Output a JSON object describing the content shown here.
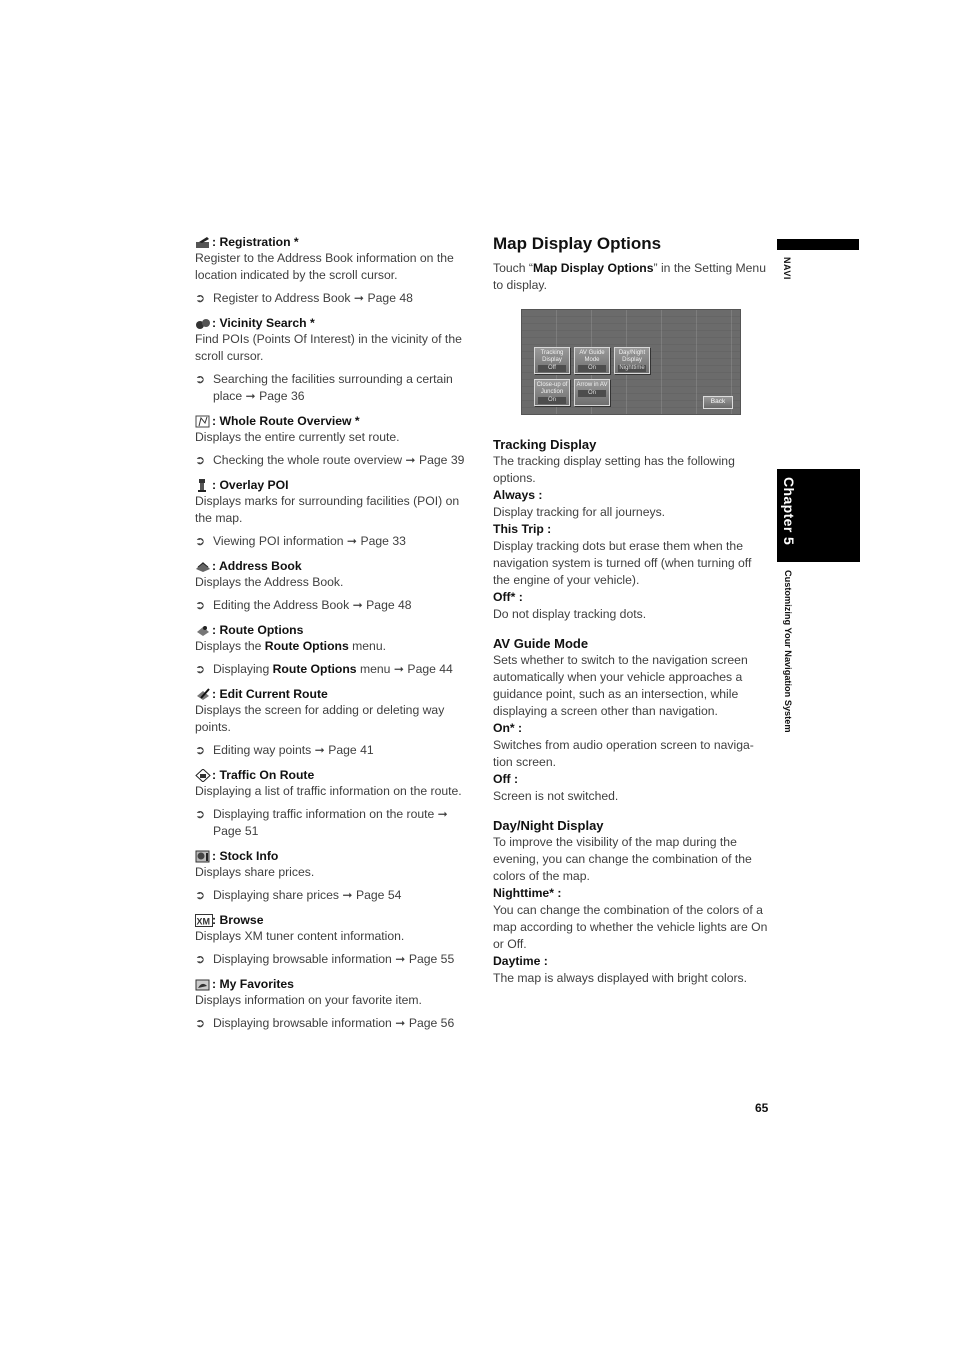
{
  "left_column": {
    "entries": [
      {
        "icon": "registration-icon",
        "title": ": Registration *",
        "desc": "Register to the Address Book information on the location indicated by the scroll cursor.",
        "ref": "Register to Address Book ➞ Page 48"
      },
      {
        "icon": "vicinity-search-icon",
        "title": ": Vicinity Search *",
        "desc": "Find POIs (Points Of Interest) in the vicinity of the scroll cursor.",
        "ref": "Searching the facilities surrounding a certain place ➞ Page 36"
      },
      {
        "icon": "whole-route-overview-icon",
        "title": ": Whole Route Overview *",
        "desc": "Displays the entire currently set route.",
        "ref": "Checking the whole route overview ➞ Page 39"
      },
      {
        "icon": "overlay-poi-icon",
        "title": " : Overlay POI",
        "desc": "Displays marks for surrounding facilities (POI) on the map.",
        "ref": "Viewing POI information ➞ Page 33"
      },
      {
        "icon": "address-book-icon",
        "title": ": Address Book",
        "desc": "Displays the Address Book.",
        "ref": "Editing the Address Book ➞ Page 48"
      },
      {
        "icon": "route-options-icon",
        "title": ": Route Options",
        "desc_pre": "Displays the ",
        "desc_bold": "Route Options",
        "desc_post": " menu.",
        "ref_pre": "Displaying ",
        "ref_bold": "Route Options",
        "ref_post": " menu ➞ Page 44"
      },
      {
        "icon": "edit-current-route-icon",
        "title": ": Edit Current Route",
        "desc": "Displays the screen for adding or deleting way points.",
        "ref": "Editing way points ➞ Page 41"
      },
      {
        "icon": "traffic-on-route-icon",
        "title": ": Traffic On Route",
        "desc": "Displaying a list of traffic information on the route.",
        "ref": "Displaying traffic information on the route ➞ Page 51"
      },
      {
        "icon": "stock-info-icon",
        "title": ": Stock Info",
        "desc": "Displays share prices.",
        "ref": "Displaying share prices ➞ Page 54"
      },
      {
        "icon": "xm-browse-icon",
        "title": " : Browse",
        "desc": "Displays XM tuner content information.",
        "ref": "Displaying browsable information ➞ Page 55"
      },
      {
        "icon": "my-favorites-icon",
        "title": ": My Favorites",
        "desc": "Displays information on your favorite item.",
        "ref": "Displaying browsable information ➞ Page 56"
      }
    ],
    "bullet": "➲"
  },
  "right_column": {
    "title": "Map Display Options",
    "intro_pre": "Touch “",
    "intro_bold": "Map Display Options",
    "intro_post": "” in the Setting Menu to display.",
    "screen": {
      "buttons": [
        {
          "label": "Tracking Display",
          "value": "Off"
        },
        {
          "label": "AV Guide Mode",
          "value": "On"
        },
        {
          "label": "Day/Night Display",
          "value": "Nighttime"
        },
        {
          "label": "Close-up of Junction",
          "value": "On"
        },
        {
          "label": "Arrow in AV",
          "value": "On"
        }
      ],
      "back": "Back"
    },
    "sections": [
      {
        "heading": "Tracking Display",
        "intro": "The tracking display setting has the following options.",
        "options": [
          {
            "label": "Always :",
            "text": "Display tracking for all journeys."
          },
          {
            "label": "This Trip :",
            "text": "Display tracking dots but erase them when the navigation system is turned off (when turning off the engine of your vehicle)."
          },
          {
            "label": "Off* :",
            "text": "Do not display tracking dots."
          }
        ]
      },
      {
        "heading": "AV Guide Mode",
        "intro": "Sets whether to switch to the navigation screen automatically when your vehicle approaches a guidance point, such as an intersection, while displaying a screen other than navigation.",
        "options": [
          {
            "label": "On* :",
            "text": "Switches from audio operation screen to naviga-tion screen."
          },
          {
            "label": "Off :",
            "text": "Screen is not switched."
          }
        ]
      },
      {
        "heading": "Day/Night Display",
        "intro": "To improve the visibility of the map during the evening, you can change the combination of the colors of the map.",
        "options": [
          {
            "label": "Nighttime* :",
            "text": "You can change the combination of the colors of a map according to whether the vehicle lights are On or Off."
          },
          {
            "label": "Daytime :",
            "text": "The map is always displayed with bright colors."
          }
        ]
      }
    ]
  },
  "side_tabs": {
    "navi": "NAVI",
    "chapter": "Chapter 5",
    "section": "Customizing Your Navigation System"
  },
  "page_number": "65"
}
